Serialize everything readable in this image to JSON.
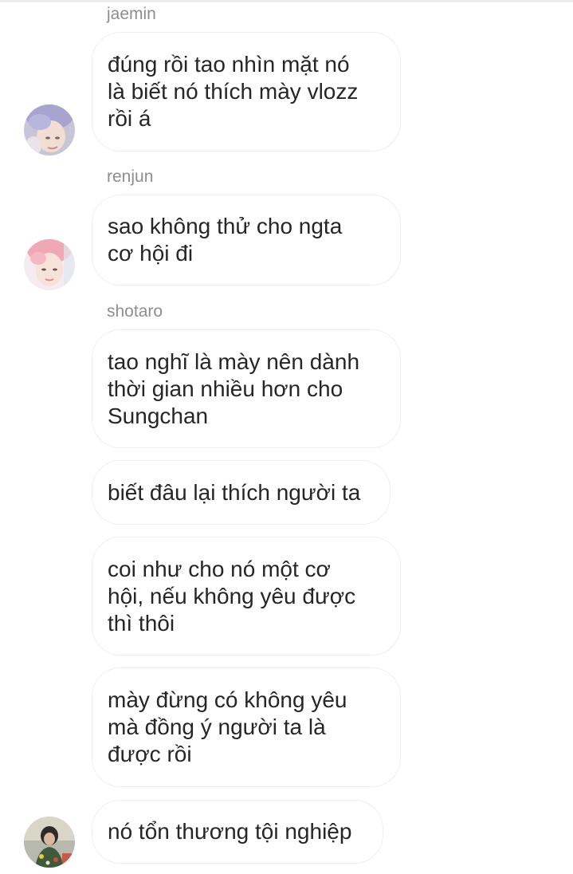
{
  "messages": [
    {
      "sender": "jaemin",
      "text": "đúng rồi tao nhìn mặt nó\nlà biết nó thích mày vlozz\nrồi á"
    },
    {
      "sender": "renjun",
      "text": "sao không thử cho ngta\ncơ hội đi"
    },
    {
      "sender": "shotaro",
      "text": "tao nghĩ là mày nên dành\nthời gian nhiều hơn cho\nSungchan"
    },
    {
      "text": "biết đâu lại thích người ta"
    },
    {
      "text": "coi như cho nó một cơ\nhội, nếu không yêu được\nthì thôi"
    },
    {
      "text": "mày đừng có không yêu\nmà đồng ý người ta là\nđược rồi"
    },
    {
      "text": "nó tổn thương tội nghiệp"
    }
  ],
  "avatars": [
    {
      "name": "jaemin",
      "icon": "profile-photo"
    },
    {
      "name": "renjun",
      "icon": "profile-photo"
    },
    {
      "name": "shotaro",
      "icon": "profile-photo"
    }
  ],
  "colors": {
    "background": "#ffffff",
    "bubble_border": "#efefef",
    "text": "#262626",
    "sender": "#8e8e8e"
  }
}
